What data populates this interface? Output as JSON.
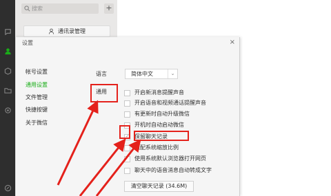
{
  "sidebar": {
    "icons": [
      "chat-icon",
      "contacts-icon",
      "favorites-icon",
      "files-icon",
      "moments-icon",
      "mini-program-icon"
    ]
  },
  "chat_list": {
    "search_placeholder": "搜索",
    "add_label": "+",
    "contacts_manage_label": "通讯录管理"
  },
  "dialog": {
    "title": "设置",
    "close_label": "×",
    "menu": [
      "帐号设置",
      "通用设置",
      "文件管理",
      "快捷按键",
      "关于微信"
    ],
    "active_menu_index": 1,
    "language_label": "语言",
    "language_value": "简体中文",
    "general_label": "通用",
    "options": [
      {
        "label": "开启新消息提醒声音",
        "checked": false
      },
      {
        "label": "开启语音和视频通话提醒声音",
        "checked": false
      },
      {
        "label": "有更新时自动升级微信",
        "checked": false
      },
      {
        "label": "开机时自动启动微信",
        "checked": false
      },
      {
        "label": "保留聊天记录",
        "checked": true
      },
      {
        "label": "适配系统缩放比例",
        "checked": false
      },
      {
        "label": "使用系统默认浏览器打开网页",
        "checked": false
      },
      {
        "label": "聊天中的语音消息自动转成文字",
        "checked": false
      }
    ],
    "clear_button_label": "清空聊天记录 (34.6M)"
  },
  "annotation_color": "#e4211b"
}
